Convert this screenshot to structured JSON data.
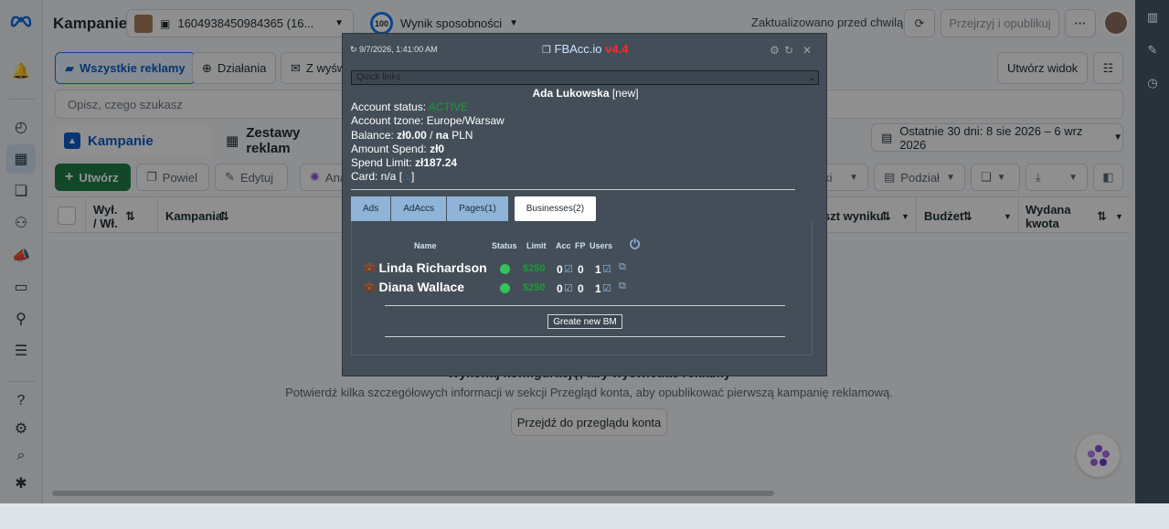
{
  "header": {
    "title": "Kampanie",
    "account_selector": "1604938450984365 (16...",
    "score_value": "100",
    "score_label": "Wynik sposobności",
    "updated": "Zaktualizowano przed chwilą",
    "review_publish": "Przejrzyj i opublikuj",
    "more": "···"
  },
  "filters": {
    "all_ads": "Wszystkie reklamy",
    "actions": "Działania",
    "from_view": "Z wyśw",
    "create_view": "Utwórz widok"
  },
  "search": {
    "placeholder": "Opisz, czego szukasz"
  },
  "tabs": {
    "campaigns": "Kampanie",
    "adsets": "Zestawy reklam"
  },
  "date_range": "Ostatnie 30 dni: 8 sie 2026 – 6 wrz 2026",
  "toolbar": {
    "create": "Utwórz",
    "duplicate": "Powiel",
    "edit": "Edytuj",
    "analyze": "Ana",
    "results": "niki",
    "breakdown": "Podział"
  },
  "table": {
    "col_delivery": "Wył. / Wł.",
    "col_campaign": "Kampania",
    "col_cost_result": "szt wyniku",
    "col_budget": "Budżet",
    "col_spent": "Wydana kwota"
  },
  "empty_state": {
    "title": "Wykonaj konfigurację, aby wyświetlać reklamy",
    "description": "Potwierdź kilka szczegółowych informacji w sekcji Przegląd konta, aby opublikować pierwszą kampanię reklamową.",
    "button": "Przejdź do przeglądu konta"
  },
  "popup": {
    "timestamp": "↻ 9/7/2026, 1:41:00 AM",
    "brand": "FBAcc.io",
    "version": "v4.4",
    "quick_links": "Quick links",
    "account_name": "Ada Lukowska",
    "account_tag": "[new]",
    "status_label": "Account status:",
    "status_value": "ACTIVE",
    "tzone_label": "Account tzone:",
    "tzone_value": "Europe/Warsaw",
    "balance_label": "Balance:",
    "balance_value": "zł0.00",
    "balance_sep": " / ",
    "balance_na": "na",
    "balance_currency": " PLN",
    "spend_label": "Amount Spend:",
    "spend_value": "zł0",
    "limit_label": "Spend Limit:",
    "limit_value": "zł187.24",
    "card_label": "Card: n/a [",
    "card_link": "...",
    "card_close": "]",
    "tabs": [
      "Ads",
      "AdAccs",
      "Pages(1)",
      "Businesses(2)"
    ],
    "columns": [
      "Name",
      "Status",
      "Limit",
      "Acc",
      "FP",
      "Users"
    ],
    "businesses": [
      {
        "name": "Linda Richardson",
        "limit": "$250",
        "acc": "0",
        "fp": "0",
        "users": "1"
      },
      {
        "name": "Diana Wallace",
        "limit": "$250",
        "acc": "0",
        "fp": "0",
        "users": "1"
      }
    ],
    "create_bm": "Greate new BM"
  },
  "colors": {
    "accent": "#1877f2",
    "create_btn": "#1f7a45",
    "status_green": "#35c25a",
    "version_red": "#ff2a2a",
    "popup_bg": "#434e58"
  }
}
